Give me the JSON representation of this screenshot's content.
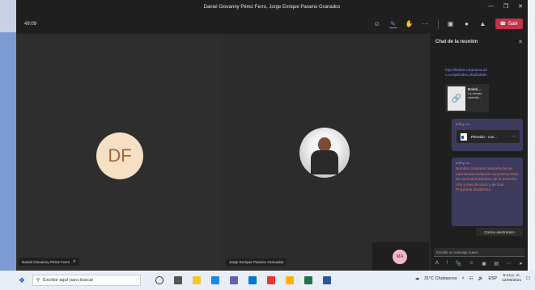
{
  "window": {
    "title": "Daniel Giovanny Pérez Ferro, Jorge Enrique Paramo Granados",
    "controls": [
      "—",
      "❐",
      "✕"
    ]
  },
  "toolbar": {
    "timer": "49:09",
    "leave_label": "Salir"
  },
  "participants": [
    {
      "name": "Daniel Giovanny Pérez Ferro",
      "initials": "DF",
      "avatar_color": "#f7dfc3"
    },
    {
      "name": "Jorge Enrique Paramo Granados",
      "initials": ""
    }
  ],
  "self_view": {
    "initials": "MA",
    "avatar_color": "#f3b8c6"
  },
  "chat": {
    "title": "Chat de la reunión",
    "link": "http://boletin.umariana.edu.co/ojs/index.php/boletin",
    "preview_title": "Boletí...",
    "preview_text": "La revista científic...",
    "messages": [
      {
        "time": "4:53 p. m.",
        "file_name": "Plenaño - con..."
      },
      {
        "time": "4:59 p. m.",
        "text": "Nombre completoCédulaFecha de nacimientoCiudad de nacimiento País de nacimientoNombre de la tesisAño: Año y mes de inicio y de final. Programa académico"
      }
    ],
    "email_button": "Correo electrónico",
    "compose_placeholder": "Escribir un mensaje nuevo"
  },
  "taskbar": {
    "search_placeholder": "Escribe aquí para buscar",
    "weather": "31°C  Chubascos",
    "language": "ESP",
    "time": "5:13 p. m.",
    "date": "12/08/2021"
  },
  "colors": {
    "leave": "#c4314b",
    "accent": "#7f85f5",
    "chat_bubble": "#3c3b5e",
    "message_text": "#e8785a"
  }
}
